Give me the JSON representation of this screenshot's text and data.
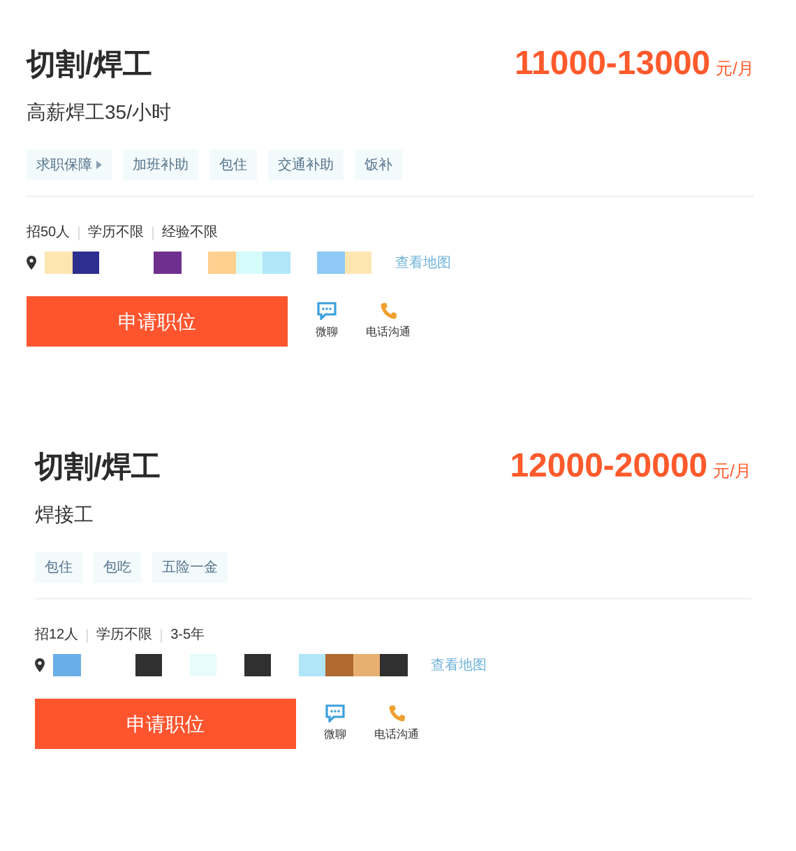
{
  "jobs": [
    {
      "title": "切割/焊工",
      "salary": "11000-13000",
      "salary_unit": "元/月",
      "subtitle": "高薪焊工35/小时",
      "tags": [
        {
          "label": "求职保障",
          "kind": "menu"
        },
        {
          "label": "加班补助",
          "kind": "plain"
        },
        {
          "label": "包住",
          "kind": "plain"
        },
        {
          "label": "交通补助",
          "kind": "plain"
        },
        {
          "label": "饭补",
          "kind": "plain"
        }
      ],
      "requirements": [
        "招50人",
        "学历不限",
        "经验不限"
      ],
      "address_blocks": [
        {
          "color": "#ffe5b0"
        },
        {
          "color": "#2e2e8f"
        },
        {
          "color": "#ffffff"
        },
        {
          "color": "#ffffff"
        },
        {
          "color": "#6f2f8f"
        },
        {
          "color": "#ffffff"
        },
        {
          "color": "#ffd08f"
        },
        {
          "color": "#d6fbfb"
        },
        {
          "color": "#b0e6f8"
        },
        {
          "color": "#ffffff"
        },
        {
          "color": "#8ecaf5"
        },
        {
          "color": "#ffe5b0"
        }
      ],
      "map_link": "查看地图",
      "apply_button": "申请职位",
      "chat_label": "微聊",
      "call_label": "电话沟通"
    },
    {
      "title": "切割/焊工",
      "salary": "12000-20000",
      "salary_unit": "元/月",
      "subtitle": "焊接工",
      "tags": [
        {
          "label": "包住",
          "kind": "plain"
        },
        {
          "label": "包吃",
          "kind": "plain"
        },
        {
          "label": "五险一金",
          "kind": "plain"
        }
      ],
      "requirements": [
        "招12人",
        "学历不限",
        "3-5年"
      ],
      "address_blocks": [
        {
          "color": "#6aaee8"
        },
        {
          "color": "#ffffff"
        },
        {
          "color": "#ffffff"
        },
        {
          "color": "#303030"
        },
        {
          "color": "#ffffff"
        },
        {
          "color": "#e8fcfc"
        },
        {
          "color": "#ffffff"
        },
        {
          "color": "#303030"
        },
        {
          "color": "#ffffff"
        },
        {
          "color": "#b0e6f8"
        },
        {
          "color": "#b06a30"
        },
        {
          "color": "#e8b070"
        },
        {
          "color": "#303030"
        }
      ],
      "map_link": "查看地图",
      "apply_button": "申请职位",
      "chat_label": "微聊",
      "call_label": "电话沟通"
    }
  ]
}
